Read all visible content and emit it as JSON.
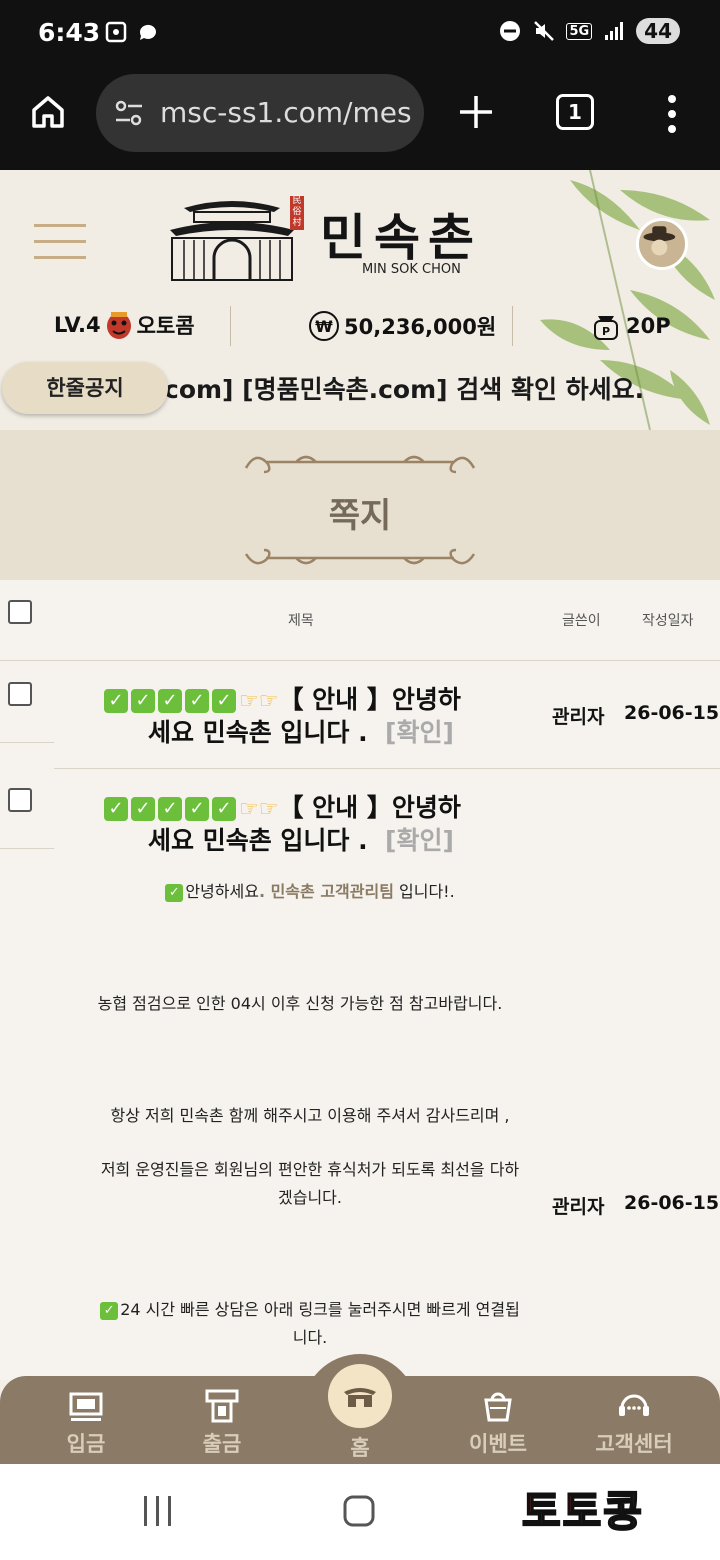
{
  "status_bar": {
    "time": "6:43",
    "battery": "44",
    "network": "5G"
  },
  "browser": {
    "url": "msc-ss1.com/mes",
    "tab_count": "1"
  },
  "header": {
    "logo_text": "민속촌",
    "logo_sub": "MIN SOK CHON",
    "logo_seal": "民俗村",
    "level": "LV.4",
    "username": "오토콤",
    "balance": "50,236,000원",
    "points": "20P",
    "notice_label": "한줄공지",
    "notice_text": "com] [명품민속촌.com] 검색 확인 하세요."
  },
  "page": {
    "title": "쪽지"
  },
  "table": {
    "columns": {
      "subject": "제목",
      "author": "글쓴이",
      "date": "작성일자"
    },
    "rows": [
      {
        "subject_line1": "【 안내 】안녕하",
        "subject_line2": "세요 민속촌 입니다 .",
        "confirm": "[확인]",
        "author": "관리자",
        "date": "26-06-15"
      },
      {
        "subject_line1": "【 안내 】안녕하",
        "subject_line2": "세요 민속촌 입니다 .",
        "confirm": "[확인]",
        "author": "관리자",
        "date": "26-06-15"
      }
    ],
    "body": {
      "greeting_pre": "안녕하세요",
      "greeting_team": ". 민속촌 고객관리팀",
      "greeting_post": " 입니다!.",
      "line2": "농협 점검으로 인한 04시 이후 신청 가능한 점 참고바랍니다.",
      "line3": "항상 저희 민속촌 함께 해주시고 이용해 주셔서 감사드리며 ,",
      "line4a": "저희 운영진들은 회원님의 편안한 휴식처가 되도록 최선을 다하",
      "line4b": "겠습니다.",
      "line5a": "24 시간 빠른 상담은 아래 링크를 눌러주시면 빠르게 연결됩",
      "line5b": "니다."
    }
  },
  "bottom_nav": {
    "deposit": "입금",
    "withdraw": "출금",
    "home": "홈",
    "event": "이벤트",
    "support": "고객센터"
  },
  "watermark": "토토콩",
  "colors": {
    "accent": "#8b7a66",
    "title": "#756a5a",
    "check": "#6bbf3a",
    "watermark": "#e0201b"
  }
}
